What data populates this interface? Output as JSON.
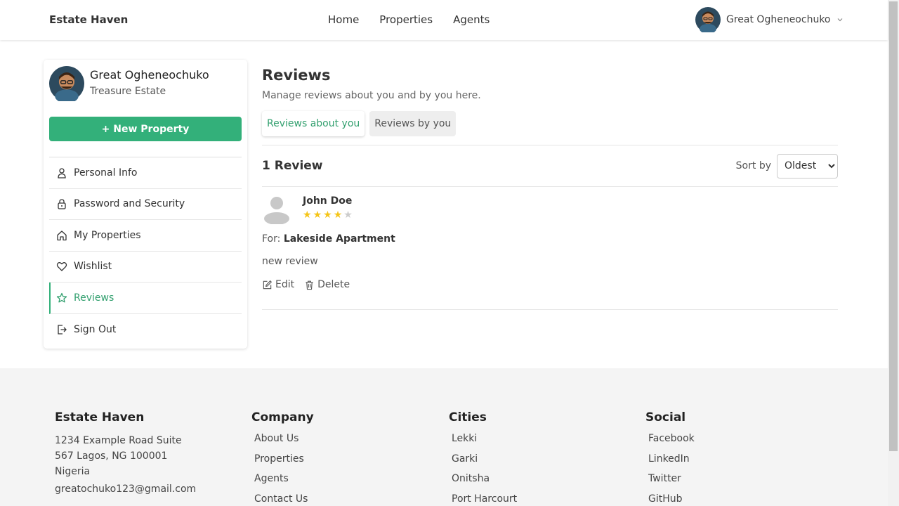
{
  "navbar": {
    "brand": "Estate Haven",
    "links": [
      "Home",
      "Properties",
      "Agents"
    ],
    "user_name": "Great Ogheneochuko"
  },
  "sidebar": {
    "name": "Great Ogheneochuko",
    "company": "Treasure Estate",
    "new_property_label": "+ New Property",
    "items": [
      {
        "label": "Personal Info",
        "icon": "user-icon"
      },
      {
        "label": "Password and Security",
        "icon": "lock-icon"
      },
      {
        "label": "My Properties",
        "icon": "home-icon"
      },
      {
        "label": "Wishlist",
        "icon": "heart-icon"
      },
      {
        "label": "Reviews",
        "icon": "star-icon"
      },
      {
        "label": "Sign Out",
        "icon": "sign-out-icon"
      }
    ],
    "active_item": "Reviews"
  },
  "main": {
    "title": "Reviews",
    "subtitle": "Manage reviews about you and by you here.",
    "tabs": [
      "Reviews about you",
      "Reviews by you"
    ],
    "active_tab": "Reviews about you",
    "review_count": "1 Review",
    "sort_label": "Sort by",
    "sort_value": "Oldest",
    "reviews": [
      {
        "reviewer": "John Doe",
        "rating": 4,
        "rating_max": 5,
        "for_label": "For:",
        "property": "Lakeside Apartment",
        "text": "new review",
        "edit_label": "Edit",
        "delete_label": "Delete"
      }
    ]
  },
  "footer": {
    "brand": "Estate Haven",
    "address_lines": [
      "1234 Example Road Suite",
      "567 Lagos, NG 100001",
      "Nigeria"
    ],
    "email": "greatochuko123@gmail.com",
    "company_title": "Company",
    "company_links": [
      "About Us",
      "Properties",
      "Agents",
      "Contact Us"
    ],
    "cities_title": "Cities",
    "cities_links": [
      "Lekki",
      "Garki",
      "Onitsha",
      "Port Harcourt"
    ],
    "social_title": "Social",
    "social_links": [
      "Facebook",
      "LinkedIn",
      "Twitter",
      "GitHub"
    ]
  },
  "colors": {
    "accent": "#33b07a",
    "star_filled": "#f5c518",
    "star_empty": "#cccccc",
    "footer_bg": "#f4f4f4"
  }
}
